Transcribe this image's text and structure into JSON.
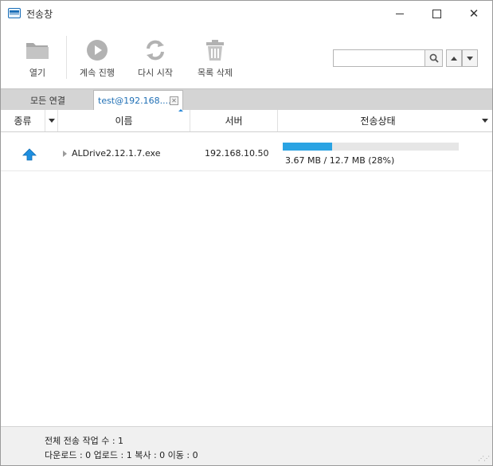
{
  "window": {
    "title": "전송창"
  },
  "toolbar": {
    "open_label": "열기",
    "continue_label": "계속 진행",
    "restart_label": "다시 시작",
    "delete_label": "목록 삭제",
    "search": {
      "value": "",
      "placeholder": ""
    }
  },
  "tabs": [
    {
      "label": "모든 연결",
      "active": false
    },
    {
      "label": "test@192.168....",
      "active": true
    }
  ],
  "columns": {
    "type": "종류",
    "name": "이름",
    "server": "서버",
    "status": "전송상태"
  },
  "rows": [
    {
      "direction_icon": "upload-arrow-icon",
      "name": "ALDrive2.12.1.7.exe",
      "server": "192.168.10.50",
      "progress": 0.28,
      "progress_text": "3.67 MB / 12.7 MB (28%)"
    }
  ],
  "footer": {
    "total_label": "전체 전송 작업 수 : 1",
    "counts_label": "다운로드 : 0  업로드 : 1  복사 : 0  이동 : 0"
  },
  "colors": {
    "accent": "#2aa3e3",
    "upload_arrow": "#1e8fe0",
    "tab_text": "#1f6fb5"
  }
}
